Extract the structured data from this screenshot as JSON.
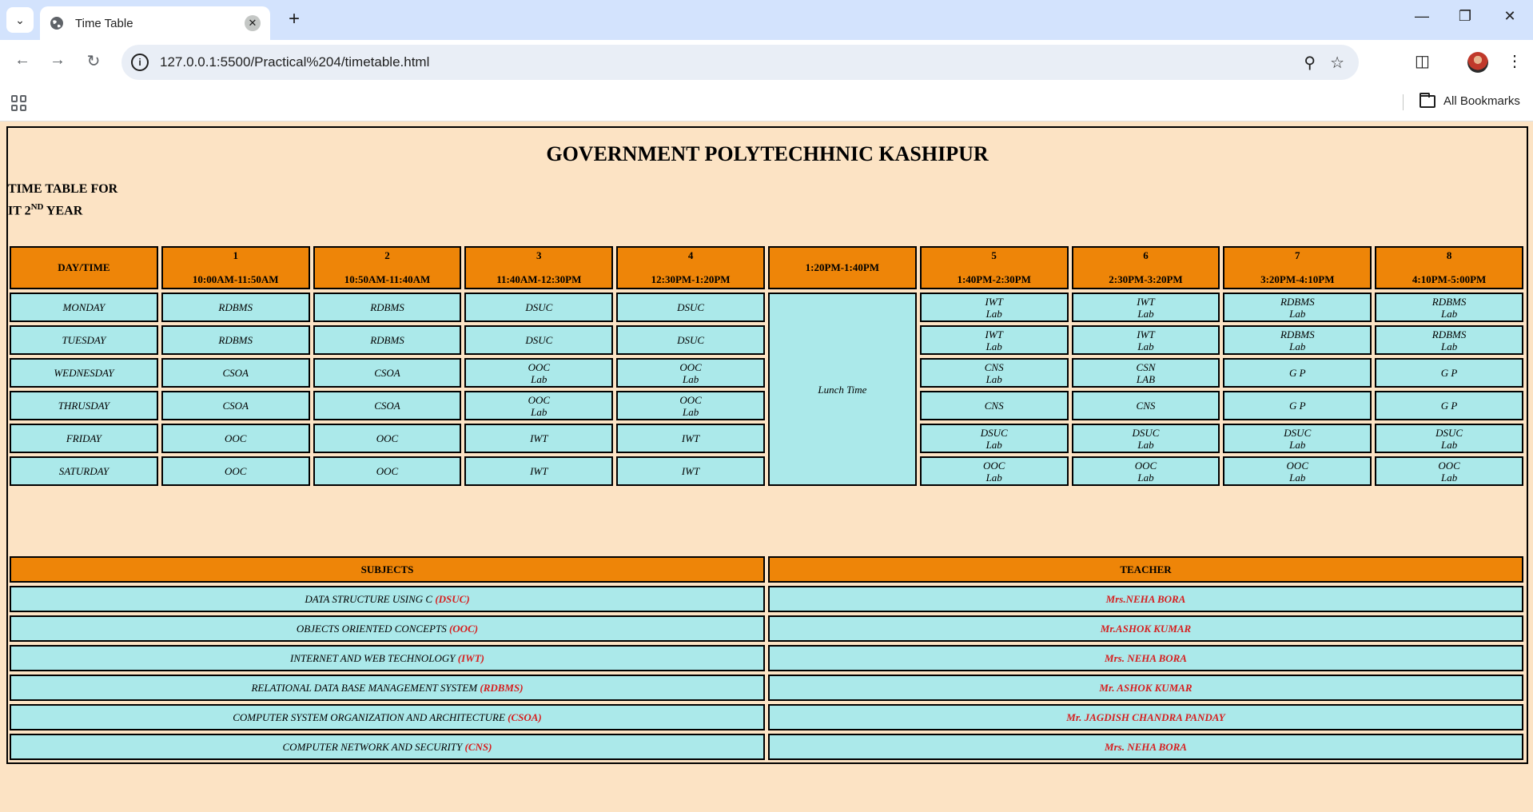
{
  "browser": {
    "tab_title": "Time Table",
    "url": "127.0.0.1:5500/Practical%204/timetable.html",
    "all_bookmarks": "All Bookmarks"
  },
  "page": {
    "college": "GOVERNMENT POLYTECHHNIC KASHIPUR",
    "caption_line1": "TIME TABLE FOR",
    "caption_line2_prefix": "IT 2",
    "caption_line2_sup": "ND",
    "caption_line2_suffix": " YEAR"
  },
  "timetable": {
    "headers": [
      {
        "num": "",
        "time": "DAY/TIME"
      },
      {
        "num": "1",
        "time": "10:00AM-11:50AM"
      },
      {
        "num": "2",
        "time": "10:50AM-11:40AM"
      },
      {
        "num": "3",
        "time": "11:40AM-12:30PM"
      },
      {
        "num": "4",
        "time": "12:30PM-1:20PM"
      },
      {
        "num": "",
        "time": "1:20PM-1:40PM"
      },
      {
        "num": "5",
        "time": "1:40PM-2:30PM"
      },
      {
        "num": "6",
        "time": "2:30PM-3:20PM"
      },
      {
        "num": "7",
        "time": "3:20PM-4:10PM"
      },
      {
        "num": "8",
        "time": "4:10PM-5:00PM"
      }
    ],
    "lunch": "Lunch Time",
    "rows": [
      {
        "day": "MONDAY",
        "before": [
          [
            "RDBMS"
          ],
          [
            "RDBMS"
          ],
          [
            "DSUC"
          ],
          [
            "DSUC"
          ]
        ],
        "after": [
          [
            "IWT",
            "Lab"
          ],
          [
            "IWT",
            "Lab"
          ],
          [
            "RDBMS",
            "Lab"
          ],
          [
            "RDBMS",
            "Lab"
          ]
        ]
      },
      {
        "day": "TUESDAY",
        "before": [
          [
            "RDBMS"
          ],
          [
            "RDBMS"
          ],
          [
            "DSUC"
          ],
          [
            "DSUC"
          ]
        ],
        "after": [
          [
            "IWT",
            "Lab"
          ],
          [
            "IWT",
            "Lab"
          ],
          [
            "RDBMS",
            "Lab"
          ],
          [
            "RDBMS",
            "Lab"
          ]
        ]
      },
      {
        "day": "WEDNESDAY",
        "before": [
          [
            "CSOA"
          ],
          [
            "CSOA"
          ],
          [
            "OOC",
            "Lab"
          ],
          [
            "OOC",
            "Lab"
          ]
        ],
        "after": [
          [
            "CNS",
            "Lab"
          ],
          [
            "CSN",
            "LAB"
          ],
          [
            "G P"
          ],
          [
            "G P"
          ]
        ]
      },
      {
        "day": "THRUSDAY",
        "before": [
          [
            "CSOA"
          ],
          [
            "CSOA"
          ],
          [
            "OOC",
            "Lab"
          ],
          [
            "OOC",
            "Lab"
          ]
        ],
        "after": [
          [
            "CNS"
          ],
          [
            "CNS"
          ],
          [
            "G P"
          ],
          [
            "G P"
          ]
        ]
      },
      {
        "day": "FRIDAY",
        "before": [
          [
            "OOC"
          ],
          [
            "OOC"
          ],
          [
            "IWT"
          ],
          [
            "IWT"
          ]
        ],
        "after": [
          [
            "DSUC",
            "Lab"
          ],
          [
            "DSUC",
            "Lab"
          ],
          [
            "DSUC",
            "Lab"
          ],
          [
            "DSUC",
            "Lab"
          ]
        ]
      },
      {
        "day": "SATURDAY",
        "before": [
          [
            "OOC"
          ],
          [
            "OOC"
          ],
          [
            "IWT"
          ],
          [
            "IWT"
          ]
        ],
        "after": [
          [
            "OOC",
            "Lab"
          ],
          [
            "OOC",
            "Lab"
          ],
          [
            "OOC",
            "Lab"
          ],
          [
            "OOC",
            "Lab"
          ]
        ]
      }
    ]
  },
  "subjects": {
    "header_subjects": "SUBJECTS",
    "header_teacher": "TEACHER",
    "rows": [
      {
        "subject": "DATA STRUCTURE USING C ",
        "abbr": "(DSUC)",
        "teacher": "Mrs.NEHA BORA"
      },
      {
        "subject": "OBJECTS ORIENTED CONCEPTS ",
        "abbr": "(OOC)",
        "teacher": "Mr.ASHOK KUMAR"
      },
      {
        "subject": "INTERNET AND WEB TECHNOLOGY ",
        "abbr": "(IWT)",
        "teacher": "Mrs. NEHA BORA"
      },
      {
        "subject": "RELATIONAL DATA BASE MANAGEMENT SYSTEM ",
        "abbr": "(RDBMS)",
        "teacher": "Mr. ASHOK KUMAR"
      },
      {
        "subject": "COMPUTER SYSTEM ORGANIZATION AND ARCHITECTURE ",
        "abbr": "(CSOA)",
        "teacher": "Mr. JAGDISH CHANDRA PANDAY"
      },
      {
        "subject": "COMPUTER NETWORK AND SECURITY ",
        "abbr": "(CNS)",
        "teacher": "Mrs. NEHA BORA"
      }
    ]
  }
}
